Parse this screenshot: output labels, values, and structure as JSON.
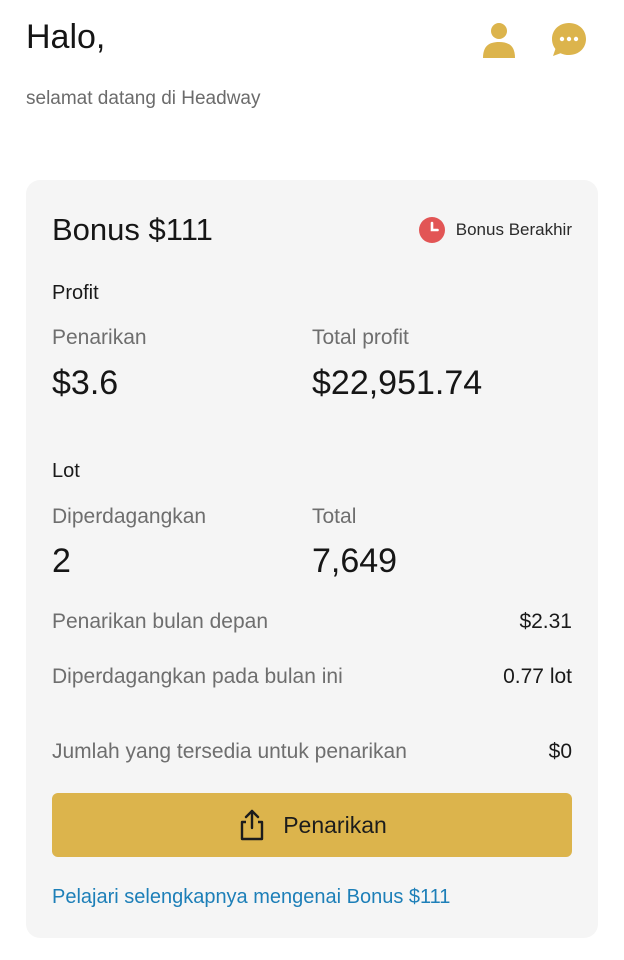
{
  "header": {
    "greeting": "Halo,",
    "subtitle": "selamat datang di Headway",
    "icons": [
      "user-icon",
      "chat-icon"
    ]
  },
  "card": {
    "title": "Bonus $111",
    "expire_label": "Bonus Berakhir",
    "profit": {
      "section_label": "Profit",
      "withdrawal_label": "Penarikan",
      "withdrawal_value": "$3.6",
      "total_label": "Total profit",
      "total_value": "$22,951.74"
    },
    "lot": {
      "section_label": "Lot",
      "traded_label": "Diperdagangkan",
      "traded_value": "2",
      "total_label": "Total",
      "total_value": "7,649"
    },
    "rows": [
      {
        "label": "Penarikan bulan depan",
        "value": "$2.31"
      },
      {
        "label": "Diperdagangkan pada bulan ini",
        "value": "0.77 lot"
      },
      {
        "label": "Jumlah yang tersedia untuk penarikan",
        "value": "$0"
      }
    ],
    "button_label": "Penarikan",
    "learn_more": "Pelajari selengkapnya mengenai Bonus $111"
  },
  "colors": {
    "accent": "#dcb44c",
    "icon": "#dcb44c",
    "clock": "#e25555",
    "link": "#1d7fb8",
    "card_bg": "#f5f5f5"
  }
}
